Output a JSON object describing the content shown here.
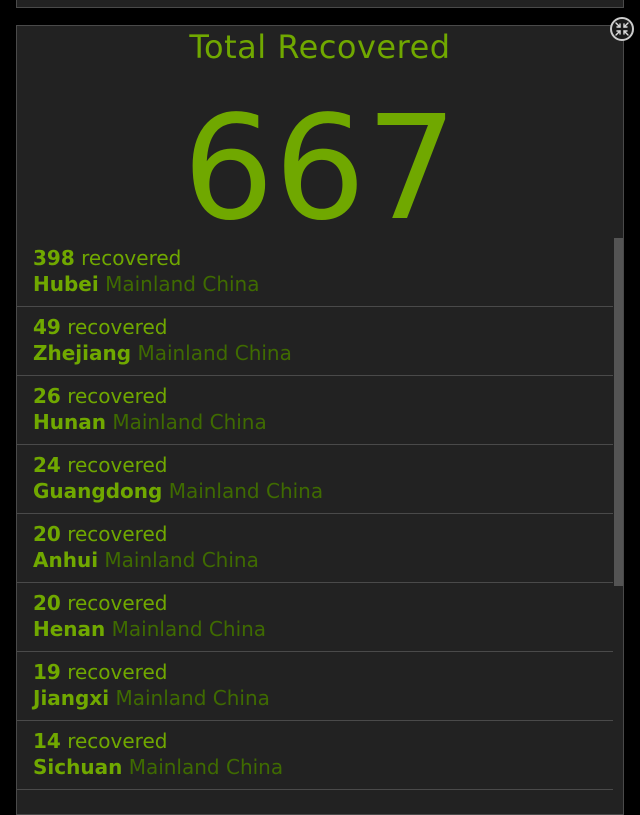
{
  "panel": {
    "title": "Total Recovered",
    "total": "667",
    "items": [
      {
        "count": "398",
        "label": "recovered",
        "region": "Hubei",
        "country": "Mainland China"
      },
      {
        "count": "49",
        "label": "recovered",
        "region": "Zhejiang",
        "country": "Mainland China"
      },
      {
        "count": "26",
        "label": "recovered",
        "region": "Hunan",
        "country": "Mainland China"
      },
      {
        "count": "24",
        "label": "recovered",
        "region": "Guangdong",
        "country": "Mainland China"
      },
      {
        "count": "20",
        "label": "recovered",
        "region": "Anhui",
        "country": "Mainland China"
      },
      {
        "count": "20",
        "label": "recovered",
        "region": "Henan",
        "country": "Mainland China"
      },
      {
        "count": "19",
        "label": "recovered",
        "region": "Jiangxi",
        "country": "Mainland China"
      },
      {
        "count": "14",
        "label": "recovered",
        "region": "Sichuan",
        "country": "Mainland China"
      }
    ]
  },
  "colors": {
    "accent": "#70a800",
    "muted_accent": "#3f6b00",
    "panel_bg": "#222222",
    "page_bg": "#000000"
  },
  "icons": {
    "collapse": "collapse-arrows-icon"
  }
}
